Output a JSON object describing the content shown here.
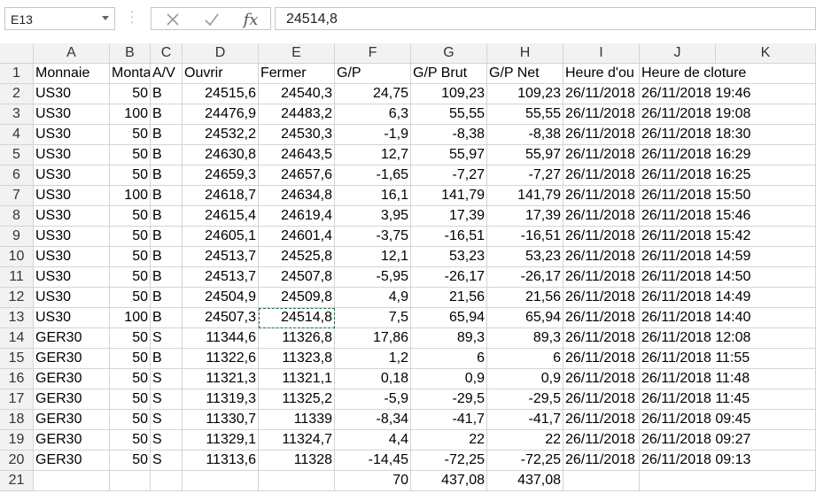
{
  "formula_bar": {
    "name_box": "E13",
    "formula": "24514,8",
    "cancel_icon": "close-icon",
    "enter_icon": "check-icon",
    "fx_label": "fx"
  },
  "columns": [
    "A",
    "B",
    "C",
    "D",
    "E",
    "F",
    "G",
    "H",
    "I",
    "J",
    "K"
  ],
  "rows": [
    {
      "n": "1",
      "cells": [
        "Monnaie",
        "Monta",
        "A/V",
        "Ouvrir",
        "Fermer",
        "G/P",
        "G/P Brut",
        "G/P Net",
        "Heure d'ou",
        "Heure de cloture",
        ""
      ]
    },
    {
      "n": "2",
      "cells": [
        "US30",
        "50",
        "B",
        "24515,6",
        "24540,3",
        "24,75",
        "109,23",
        "109,23",
        "26/11/2018",
        "26/11/2018 19:46",
        ""
      ]
    },
    {
      "n": "3",
      "cells": [
        "US30",
        "100",
        "B",
        "24476,9",
        "24483,2",
        "6,3",
        "55,55",
        "55,55",
        "26/11/2018",
        "26/11/2018 19:08",
        ""
      ]
    },
    {
      "n": "4",
      "cells": [
        "US30",
        "50",
        "B",
        "24532,2",
        "24530,3",
        "-1,9",
        "-8,38",
        "-8,38",
        "26/11/2018",
        "26/11/2018 18:30",
        ""
      ]
    },
    {
      "n": "5",
      "cells": [
        "US30",
        "50",
        "B",
        "24630,8",
        "24643,5",
        "12,7",
        "55,97",
        "55,97",
        "26/11/2018",
        "26/11/2018 16:29",
        ""
      ]
    },
    {
      "n": "6",
      "cells": [
        "US30",
        "50",
        "B",
        "24659,3",
        "24657,6",
        "-1,65",
        "-7,27",
        "-7,27",
        "26/11/2018",
        "26/11/2018 16:25",
        ""
      ]
    },
    {
      "n": "7",
      "cells": [
        "US30",
        "100",
        "B",
        "24618,7",
        "24634,8",
        "16,1",
        "141,79",
        "141,79",
        "26/11/2018",
        "26/11/2018 15:50",
        ""
      ]
    },
    {
      "n": "8",
      "cells": [
        "US30",
        "50",
        "B",
        "24615,4",
        "24619,4",
        "3,95",
        "17,39",
        "17,39",
        "26/11/2018",
        "26/11/2018 15:46",
        ""
      ]
    },
    {
      "n": "9",
      "cells": [
        "US30",
        "50",
        "B",
        "24605,1",
        "24601,4",
        "-3,75",
        "-16,51",
        "-16,51",
        "26/11/2018",
        "26/11/2018 15:42",
        ""
      ]
    },
    {
      "n": "10",
      "cells": [
        "US30",
        "50",
        "B",
        "24513,7",
        "24525,8",
        "12,1",
        "53,23",
        "53,23",
        "26/11/2018",
        "26/11/2018 14:59",
        ""
      ]
    },
    {
      "n": "11",
      "cells": [
        "US30",
        "50",
        "B",
        "24513,7",
        "24507,8",
        "-5,95",
        "-26,17",
        "-26,17",
        "26/11/2018",
        "26/11/2018 14:50",
        ""
      ]
    },
    {
      "n": "12",
      "cells": [
        "US30",
        "50",
        "B",
        "24504,9",
        "24509,8",
        "4,9",
        "21,56",
        "21,56",
        "26/11/2018",
        "26/11/2018 14:49",
        ""
      ]
    },
    {
      "n": "13",
      "cells": [
        "US30",
        "100",
        "B",
        "24507,3",
        "24514,8",
        "7,5",
        "65,94",
        "65,94",
        "26/11/2018",
        "26/11/2018 14:40",
        ""
      ]
    },
    {
      "n": "14",
      "cells": [
        "GER30",
        "50",
        "S",
        "11344,6",
        "11326,8",
        "17,86",
        "89,3",
        "89,3",
        "26/11/2018",
        "26/11/2018 12:08",
        ""
      ]
    },
    {
      "n": "15",
      "cells": [
        "GER30",
        "50",
        "B",
        "11322,6",
        "11323,8",
        "1,2",
        "6",
        "6",
        "26/11/2018",
        "26/11/2018 11:55",
        ""
      ]
    },
    {
      "n": "16",
      "cells": [
        "GER30",
        "50",
        "S",
        "11321,3",
        "11321,1",
        "0,18",
        "0,9",
        "0,9",
        "26/11/2018",
        "26/11/2018 11:48",
        ""
      ]
    },
    {
      "n": "17",
      "cells": [
        "GER30",
        "50",
        "S",
        "11319,3",
        "11325,2",
        "-5,9",
        "-29,5",
        "-29,5",
        "26/11/2018",
        "26/11/2018 11:45",
        ""
      ]
    },
    {
      "n": "18",
      "cells": [
        "GER30",
        "50",
        "S",
        "11330,7",
        "11339",
        "-8,34",
        "-41,7",
        "-41,7",
        "26/11/2018",
        "26/11/2018 09:45",
        ""
      ]
    },
    {
      "n": "19",
      "cells": [
        "GER30",
        "50",
        "S",
        "11329,1",
        "11324,7",
        "4,4",
        "22",
        "22",
        "26/11/2018",
        "26/11/2018 09:27",
        ""
      ]
    },
    {
      "n": "20",
      "cells": [
        "GER30",
        "50",
        "S",
        "11313,6",
        "11328",
        "-14,45",
        "-72,25",
        "-72,25",
        "26/11/2018",
        "26/11/2018 09:13",
        ""
      ]
    },
    {
      "n": "21",
      "cells": [
        "",
        "",
        "",
        "",
        "",
        "70",
        "437,08",
        "437,08",
        "",
        "",
        ""
      ]
    }
  ]
}
